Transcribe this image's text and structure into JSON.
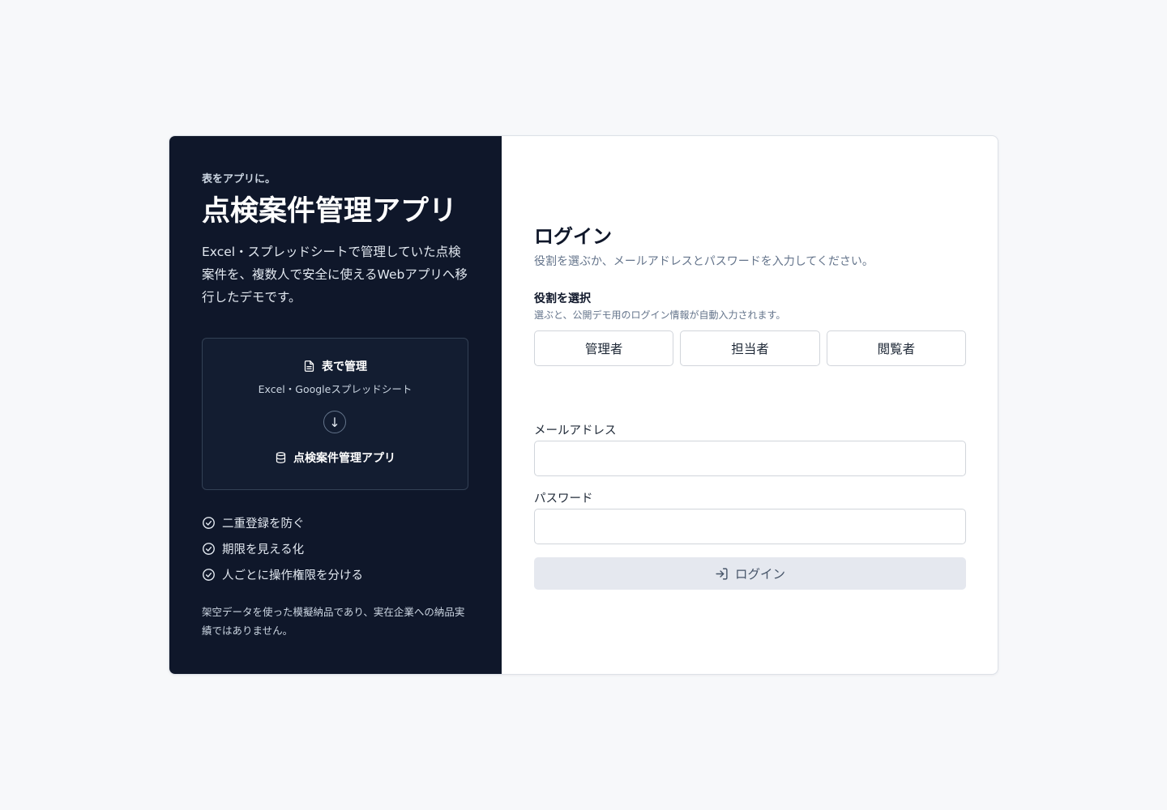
{
  "brand": {
    "eyebrow": "表をアプリに。",
    "title": "点検案件管理アプリ",
    "intro": "Excel・スプレッドシートで管理していた点検案件を、複数人で安全に使えるWebアプリへ移行したデモです。"
  },
  "flow": {
    "from_label": "表で管理",
    "from_sub": "Excel・Googleスプレッドシート",
    "arrow": "↓",
    "to_label": "点検案件管理アプリ",
    "from_icon": "file-text-icon",
    "to_icon": "database-icon"
  },
  "features": [
    {
      "label": "二重登録を防ぐ",
      "icon": "check-circle-icon"
    },
    {
      "label": "期限を見える化",
      "icon": "check-circle-icon"
    },
    {
      "label": "人ごとに操作権限を分ける",
      "icon": "check-circle-icon"
    }
  ],
  "disclaimer": "架空データを使った模擬納品であり、実在企業への納品実績ではありません。",
  "login": {
    "title": "ログイン",
    "subtitle": "役割を選ぶか、メールアドレスとパスワードを入力してください。",
    "role_label": "役割を選択",
    "role_hint": "選ぶと、公開デモ用のログイン情報が自動入力されます。",
    "roles": [
      "管理者",
      "担当者",
      "閲覧者"
    ],
    "email_label": "メールアドレス",
    "email_value": "",
    "password_label": "パスワード",
    "password_value": "",
    "submit_label": "ログイン",
    "submit_icon": "log-in-icon"
  },
  "colors": {
    "page_bg": "#f7f8fa",
    "left_panel_bg": "#0f172a",
    "submit_bg": "#e5e8ef"
  }
}
